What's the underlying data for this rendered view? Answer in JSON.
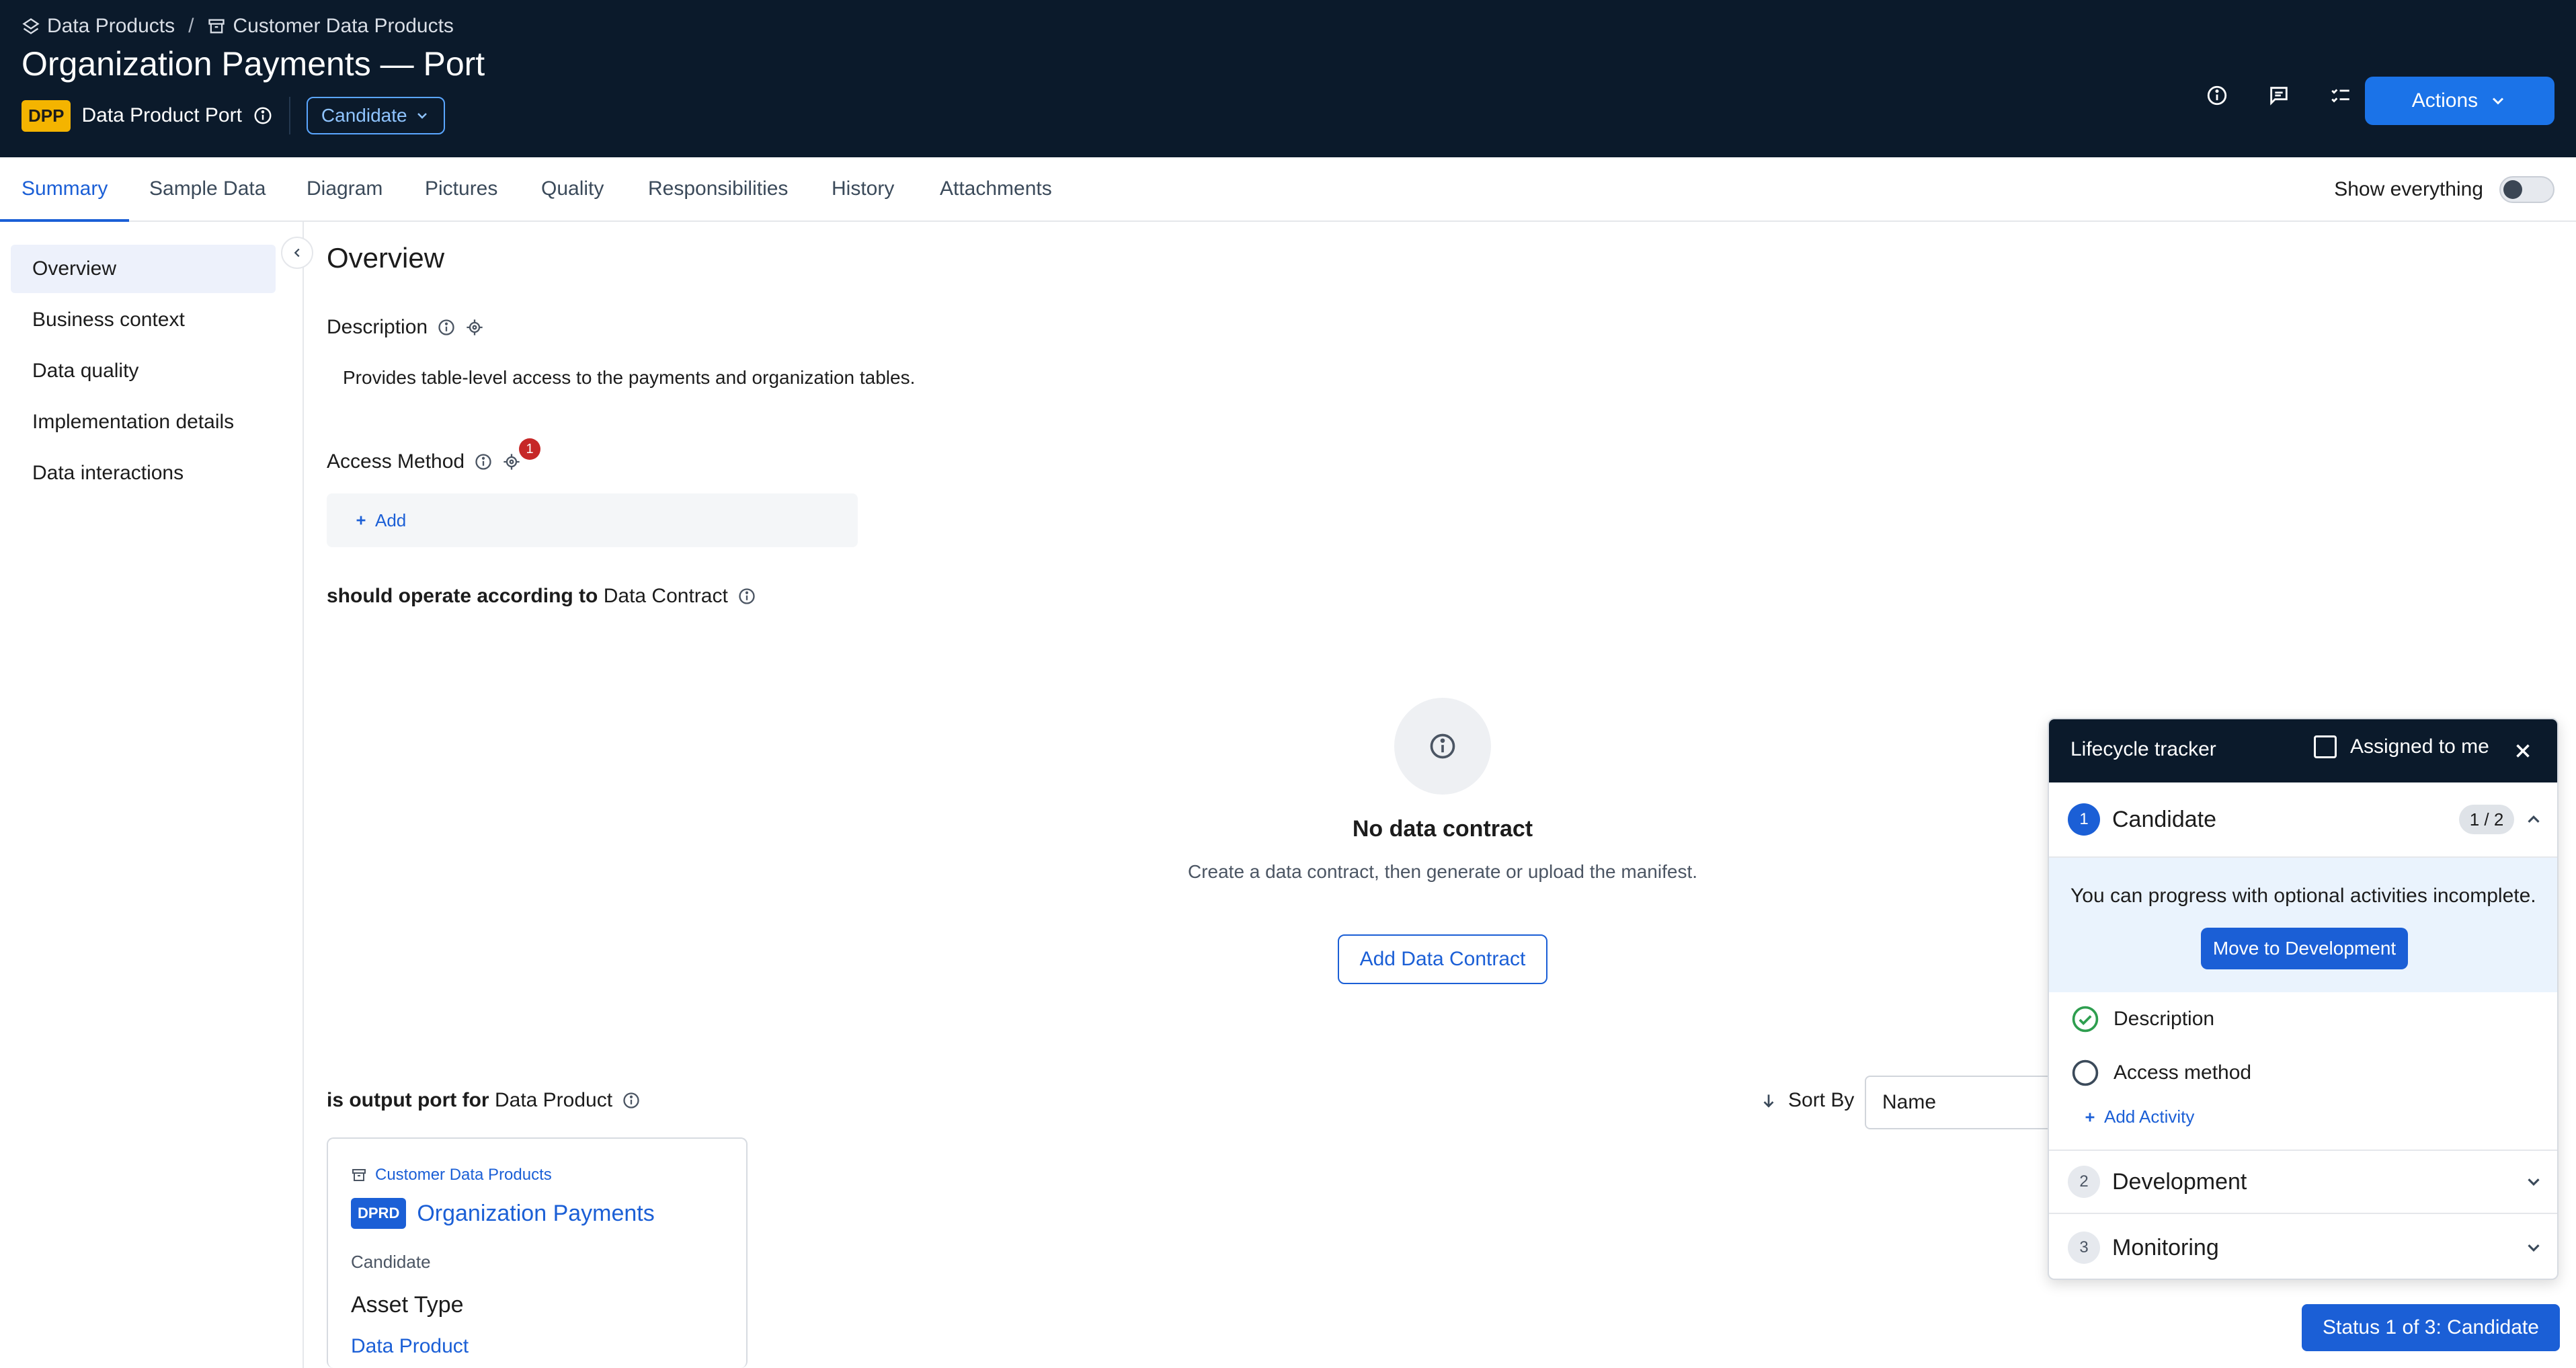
{
  "header": {
    "breadcrumbs": [
      "Data Products",
      "Customer Data Products"
    ],
    "separator": "/",
    "title": "Organization Payments — Port",
    "type_badge": "DPP",
    "type_label": "Data Product Port",
    "status_dropdown": "Candidate",
    "actions_label": "Actions",
    "icons": [
      "info-icon",
      "comment-icon",
      "checklist-icon",
      "more-vertical-icon"
    ]
  },
  "tabs": [
    "Summary",
    "Sample Data",
    "Diagram",
    "Pictures",
    "Quality",
    "Responsibilities",
    "History",
    "Attachments"
  ],
  "show_everything_label": "Show everything",
  "sidebar": {
    "items": [
      "Overview",
      "Business context",
      "Data quality",
      "Implementation details",
      "Data interactions"
    ]
  },
  "main": {
    "heading": "Overview",
    "description_label": "Description",
    "description_text": "Provides table-level access to the payments and organization tables.",
    "access_method_label": "Access Method",
    "access_method_badge": "1",
    "add_label": "Add",
    "contract_relation_prefix": "should operate according to",
    "contract_relation_target": "Data Contract",
    "empty_title": "No data contract",
    "empty_text": "Create a data contract, then generate or upload the manifest.",
    "add_contract_label": "Add Data Contract",
    "output_relation_prefix": "is output port for",
    "output_relation_target": "Data Product",
    "sort_by_label": "Sort By",
    "sort_value": "Name",
    "card": {
      "crumb": "Customer Data Products",
      "badge": "DPRD",
      "title": "Organization Payments",
      "status": "Candidate",
      "asset_type_label": "Asset Type",
      "asset_type_value": "Data Product"
    }
  },
  "tracker": {
    "title": "Lifecycle tracker",
    "assigned_label": "Assigned to me",
    "stages": [
      {
        "num": "1",
        "name": "Candidate",
        "count": "1 / 2"
      },
      {
        "num": "2",
        "name": "Development"
      },
      {
        "num": "3",
        "name": "Monitoring"
      }
    ],
    "info_text": "You can progress with optional activities incomplete.",
    "move_label": "Move to Development",
    "activities": [
      "Description",
      "Access method"
    ],
    "add_activity_label": "Add Activity"
  },
  "status_button": "Status 1 of 3: Candidate",
  "colors": {
    "header_bg": "#0b1a2b",
    "accent": "#1b5fd6",
    "badge_yellow": "#f4b400",
    "success": "#2e9e4f",
    "alert": "#c62828"
  }
}
